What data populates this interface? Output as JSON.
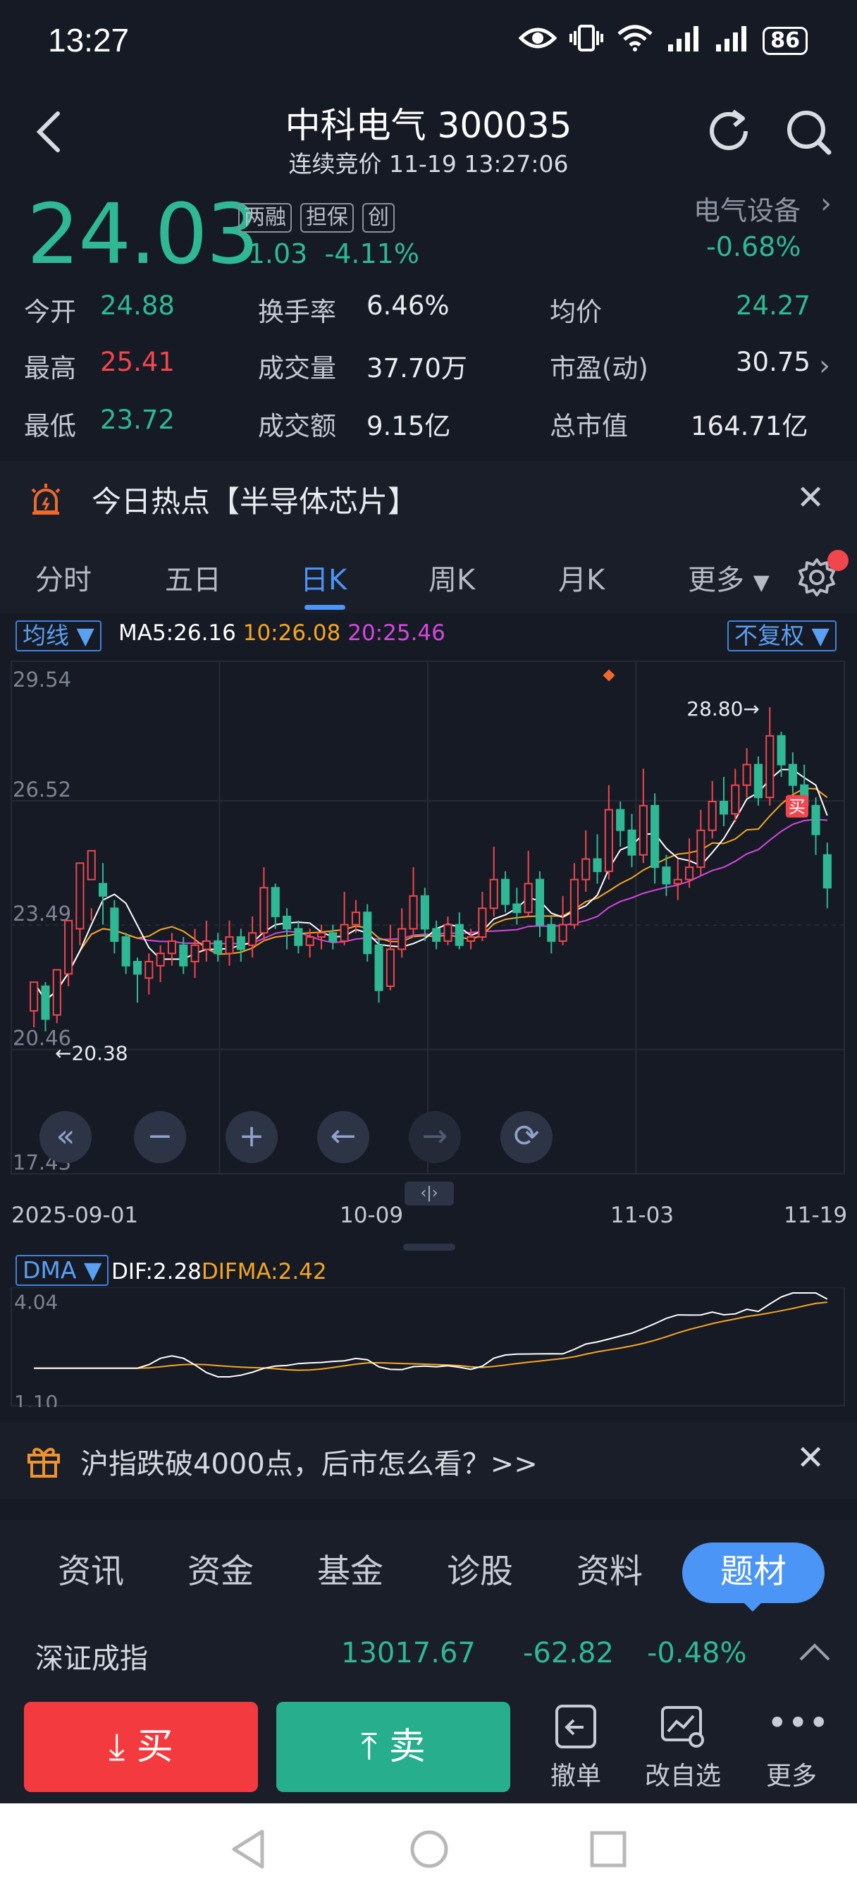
{
  "status_bar": {
    "time": "13:27",
    "battery": "86"
  },
  "header": {
    "title": "中科电气 300035",
    "subtitle": "连续竞价 11-19 13:27:06"
  },
  "price": {
    "last": "24.03",
    "change": "-1.03",
    "change_pct": "-4.11%",
    "tags": [
      "两融",
      "担保",
      "创"
    ],
    "sector": "电气设备",
    "sector_change": "-0.68%"
  },
  "quote": {
    "open_label": "今开",
    "open": "24.88",
    "high_label": "最高",
    "high": "25.41",
    "low_label": "最低",
    "low": "23.72",
    "turnover_label": "换手率",
    "turnover": "6.46%",
    "volume_label": "成交量",
    "volume": "37.70万",
    "amount_label": "成交额",
    "amount": "9.15亿",
    "avg_label": "均价",
    "avg": "24.27",
    "pe_label": "市盈(动)",
    "pe": "30.75",
    "mcap_label": "总市值",
    "mcap": "164.71亿"
  },
  "hot_banner": {
    "text": "今日热点【半导体芯片】"
  },
  "kline_tabs": {
    "items": [
      "分时",
      "五日",
      "日K",
      "周K",
      "月K",
      "更多"
    ],
    "active": "日K"
  },
  "chart_toolbar": {
    "indicator": "均线",
    "ma5": "MA5:26.16",
    "ma10": "10:26.08",
    "ma20": "20:25.46",
    "adjust": "不复权"
  },
  "colors": {
    "up": "#f2464f",
    "down": "#2fb894",
    "ma5": "#ffffff",
    "ma10": "#f5a623",
    "ma20": "#d447e0",
    "accent": "#4a95f5"
  },
  "chart_data": [
    {
      "type": "candlestick",
      "y_ticks": [
        "29.54",
        "26.52",
        "23.49",
        "20.46",
        "17.43"
      ],
      "ylim": [
        17.43,
        29.54
      ],
      "x_labels": [
        "2025-09-01",
        "10-09",
        "11-03",
        "11-19"
      ],
      "annotations": {
        "max": "28.80→",
        "min": "←20.38",
        "trade_marker": "买"
      },
      "candles": [
        [
          21.4,
          22.1,
          21.0,
          22.0
        ],
        [
          22.0,
          21.2,
          20.9,
          22.1
        ],
        [
          21.3,
          22.4,
          21.1,
          22.3
        ],
        [
          22.3,
          23.6,
          22.0,
          23.4
        ],
        [
          23.4,
          25.0,
          23.0,
          24.6
        ],
        [
          24.6,
          25.3,
          23.6,
          23.9
        ],
        [
          24.5,
          24.2,
          23.5,
          25.0
        ],
        [
          23.9,
          23.1,
          22.8,
          24.1
        ],
        [
          23.2,
          22.5,
          22.3,
          23.3
        ],
        [
          22.6,
          22.3,
          21.6,
          22.7
        ],
        [
          22.2,
          22.6,
          21.8,
          22.8
        ],
        [
          22.5,
          22.8,
          22.1,
          23.0
        ],
        [
          22.8,
          23.1,
          22.5,
          23.3
        ],
        [
          23.0,
          22.5,
          22.3,
          23.2
        ],
        [
          22.6,
          23.0,
          22.2,
          23.4
        ],
        [
          22.9,
          23.1,
          22.6,
          23.6
        ],
        [
          23.1,
          22.8,
          22.6,
          23.3
        ],
        [
          22.8,
          23.2,
          22.5,
          23.6
        ],
        [
          23.2,
          22.9,
          22.6,
          23.4
        ],
        [
          23.0,
          23.3,
          22.7,
          23.7
        ],
        [
          23.3,
          24.4,
          23.1,
          24.9
        ],
        [
          24.4,
          23.7,
          23.4,
          24.5
        ],
        [
          23.7,
          23.4,
          22.9,
          23.9
        ],
        [
          23.4,
          23.0,
          22.8,
          23.6
        ],
        [
          23.0,
          23.2,
          22.7,
          23.4
        ],
        [
          23.2,
          23.3,
          22.9,
          23.5
        ],
        [
          23.3,
          23.1,
          22.9,
          23.5
        ],
        [
          23.1,
          23.5,
          23.0,
          24.3
        ],
        [
          23.5,
          23.8,
          23.3,
          24.1
        ],
        [
          23.8,
          22.8,
          22.6,
          24.0
        ],
        [
          23.0,
          21.9,
          21.6,
          23.2
        ],
        [
          22.0,
          22.9,
          21.9,
          23.5
        ],
        [
          22.9,
          23.4,
          22.7,
          23.9
        ],
        [
          23.4,
          24.2,
          23.2,
          24.9
        ],
        [
          24.2,
          23.4,
          23.1,
          24.4
        ],
        [
          23.4,
          23.1,
          22.9,
          23.6
        ],
        [
          23.1,
          23.5,
          23.0,
          23.7
        ],
        [
          23.5,
          23.0,
          22.9,
          23.8
        ],
        [
          23.1,
          23.2,
          22.9,
          23.4
        ],
        [
          23.2,
          23.9,
          23.1,
          24.3
        ],
        [
          23.9,
          24.6,
          23.7,
          25.4
        ],
        [
          24.6,
          24.0,
          23.8,
          24.8
        ],
        [
          24.0,
          23.8,
          23.5,
          24.4
        ],
        [
          23.8,
          24.5,
          23.7,
          25.3
        ],
        [
          24.6,
          23.5,
          23.2,
          24.8
        ],
        [
          23.5,
          23.1,
          22.8,
          23.7
        ],
        [
          23.1,
          23.5,
          23.0,
          24.2
        ],
        [
          23.5,
          24.6,
          23.4,
          25.0
        ],
        [
          24.6,
          25.1,
          24.3,
          25.8
        ],
        [
          25.1,
          24.8,
          24.5,
          25.7
        ],
        [
          24.8,
          26.3,
          24.6,
          26.9
        ],
        [
          26.3,
          25.8,
          25.4,
          26.5
        ],
        [
          25.8,
          25.2,
          24.9,
          26.2
        ],
        [
          25.2,
          26.4,
          25.0,
          27.3
        ],
        [
          26.4,
          24.9,
          24.5,
          26.7
        ],
        [
          24.9,
          24.5,
          24.2,
          25.2
        ],
        [
          24.5,
          24.6,
          24.1,
          25.1
        ],
        [
          24.6,
          24.9,
          24.4,
          25.6
        ],
        [
          24.9,
          25.8,
          24.7,
          26.3
        ],
        [
          25.8,
          26.5,
          25.6,
          27.0
        ],
        [
          26.5,
          26.2,
          25.9,
          27.1
        ],
        [
          26.2,
          26.9,
          26.0,
          27.3
        ],
        [
          26.9,
          27.4,
          26.6,
          27.8
        ],
        [
          27.4,
          26.6,
          26.4,
          27.6
        ],
        [
          26.6,
          28.1,
          26.4,
          28.8
        ],
        [
          28.1,
          27.4,
          27.1,
          28.2
        ],
        [
          27.4,
          26.9,
          26.7,
          27.7
        ],
        [
          26.9,
          26.4,
          26.2,
          27.4
        ],
        [
          26.4,
          25.7,
          25.2,
          26.6
        ],
        [
          25.2,
          24.4,
          23.9,
          25.5
        ]
      ]
    },
    {
      "type": "line",
      "indicator": "DMA",
      "dif": "DIF:2.28",
      "difma": "DIFMA:2.42",
      "y_ticks": [
        "4.04",
        "1.10"
      ],
      "ylim": [
        1.0,
        4.3
      ]
    }
  ],
  "news_banner": {
    "text": "沪指跌破4000点，后市怎么看？>>"
  },
  "info_tabs": {
    "items": [
      "资讯",
      "资金",
      "基金",
      "诊股",
      "资料"
    ],
    "active": "题材"
  },
  "index_bar": {
    "name": "深证成指",
    "value": "13017.67",
    "change": "-62.82",
    "change_pct": "-0.48%"
  },
  "actions": {
    "buy": "买",
    "sell": "卖",
    "cancel": "撤单",
    "edit_watch": "改自选",
    "more": "更多"
  }
}
